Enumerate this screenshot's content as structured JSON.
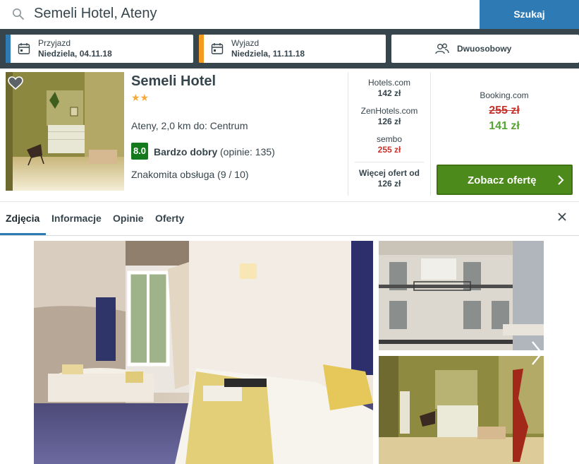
{
  "search": {
    "query": "Semeli Hotel, Ateny",
    "button_label": "Szukaj",
    "checkin_label": "Przyjazd",
    "checkin_value": "Niedziela, 04.11.18",
    "checkout_label": "Wyjazd",
    "checkout_value": "Niedziela, 11.11.18",
    "room_value": "Dwuosobowy"
  },
  "colors": {
    "accent_blue": "#2d7ab5",
    "checkin_stripe": "#2d7ab5",
    "checkout_stripe": "#f39a21",
    "cta_green": "#4c8a1b",
    "price_red": "#c7322c",
    "price_green": "#55a432"
  },
  "hotel": {
    "name": "Semeli Hotel",
    "stars": "★★",
    "location": "Ateny, 2,0 km do: Centrum",
    "rating_score": "8.0",
    "rating_word": "Bardzo dobry",
    "rating_count": "(opinie: 135)",
    "service_note": "Znakomita obsługa (9 / 10)"
  },
  "offers": [
    {
      "site": "Hotels.com",
      "price": "142 zł",
      "price_color": "#37454d"
    },
    {
      "site": "ZenHotels.com",
      "price": "126 zł",
      "price_color": "#37454d"
    },
    {
      "site": "sembo",
      "price": "255 zł",
      "price_color": "#c7322c"
    }
  ],
  "more_offers": {
    "label": "Więcej ofert od",
    "price": "126 zł"
  },
  "best_offer": {
    "site": "Booking.com",
    "old_price": "255 zł",
    "new_price": "141 zł",
    "cta_label": "Zobacz ofertę"
  },
  "tabs": [
    {
      "label": "Zdjęcia",
      "active": true
    },
    {
      "label": "Informacje",
      "active": false
    },
    {
      "label": "Opinie",
      "active": false
    },
    {
      "label": "Oferty",
      "active": false
    }
  ]
}
